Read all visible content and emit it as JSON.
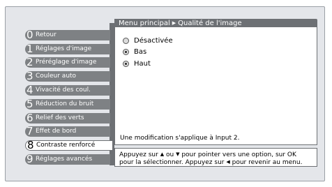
{
  "breadcrumb": {
    "parent": "Menu principal",
    "separator": "▶",
    "current": "Qualité de l'image"
  },
  "menu": [
    {
      "num": "0",
      "label": "Retour"
    },
    {
      "num": "1",
      "label": "Réglages d'image"
    },
    {
      "num": "2",
      "label": "Préréglage d'image"
    },
    {
      "num": "3",
      "label": "Couleur auto"
    },
    {
      "num": "4",
      "label": "Vivacité des coul."
    },
    {
      "num": "5",
      "label": "Réduction du bruit"
    },
    {
      "num": "6",
      "label": "Relief des verts"
    },
    {
      "num": "7",
      "label": "Effet de bord"
    },
    {
      "num": "8",
      "label": "Contraste renforcé"
    },
    {
      "num": "9",
      "label": "Réglages avancés"
    }
  ],
  "options": [
    {
      "label": "Désactivée",
      "selected": false
    },
    {
      "label": "Bas",
      "selected": true
    },
    {
      "label": "Haut",
      "selected": true
    }
  ],
  "status": "Une modification s'applique à  Input 2.",
  "help": {
    "part1": "Appuyez sur",
    "up": "▲",
    "part2": "ou",
    "down": "▼",
    "part3": "pour pointer vers une option, sur OK",
    "line2a": "pour la sélectionner. Appuyez sur",
    "left": "◀",
    "line2b": "pour revenir au menu."
  },
  "colors": {
    "bar": "#6d7074",
    "menu_item": "#7e8184",
    "frame": "#e4e6ea"
  }
}
